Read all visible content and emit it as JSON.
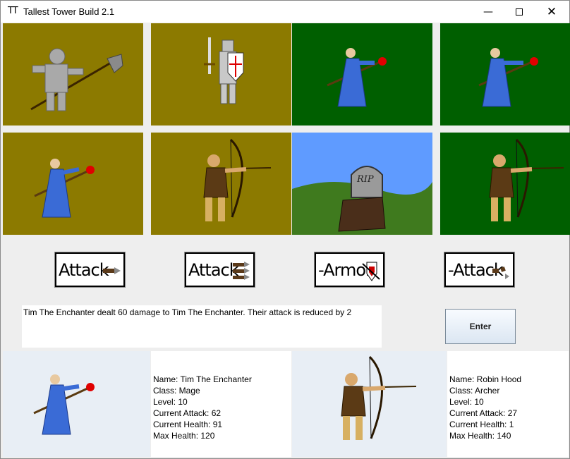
{
  "window": {
    "title": "Tallest Tower Build 2.1",
    "app_icon": "TT",
    "minimize_glyph": "—",
    "close_glyph": "✕"
  },
  "tiles": [
    {
      "name": "armored-knight-halberd",
      "bg": "olive",
      "status": "alive"
    },
    {
      "name": "crusader-knight",
      "bg": "olive",
      "status": "alive"
    },
    {
      "name": "mage",
      "bg": "green",
      "status": "alive"
    },
    {
      "name": "mage",
      "bg": "green",
      "status": "alive"
    },
    {
      "name": "mage",
      "bg": "olive",
      "status": "alive"
    },
    {
      "name": "archer",
      "bg": "olive",
      "status": "alive"
    },
    {
      "name": "gravestone",
      "bg": "sky",
      "status": "dead",
      "grave_text": "RIP"
    },
    {
      "name": "archer",
      "bg": "green",
      "status": "alive"
    }
  ],
  "actions": [
    {
      "label": "Attack",
      "icon": "single-arrow-icon"
    },
    {
      "label": "Attack",
      "icon": "triple-arrow-icon"
    },
    {
      "label": "-Armor",
      "icon": "shield-arrow-icon"
    },
    {
      "label": "-Attack",
      "icon": "broken-arrow-icon"
    }
  ],
  "log": {
    "message": "Tim The Enchanter dealt 60 damage to Tim The Enchanter. Their attack is reduced by 2"
  },
  "enter_button": {
    "label": "Enter"
  },
  "player_left": {
    "name_line": "Name: Tim The Enchanter",
    "class_line": "Class: Mage",
    "level_line": "Level: 10",
    "attack_line": "Current Attack: 62",
    "health_line": "Current Health: 91",
    "max_health_line": "Max Health: 120"
  },
  "player_right": {
    "name_line": "Name: Robin Hood",
    "class_line": "Class: Archer",
    "level_line": "Level: 10",
    "attack_line": "Current Attack: 27",
    "health_line": "Current Health: 1",
    "max_health_line": "Max Health: 140"
  },
  "colors": {
    "olive": "#8c7a00",
    "forest": "#005f00",
    "sky": "#5f9bff",
    "mage_robe": "#3a6bd6",
    "orb": "#e00000"
  }
}
